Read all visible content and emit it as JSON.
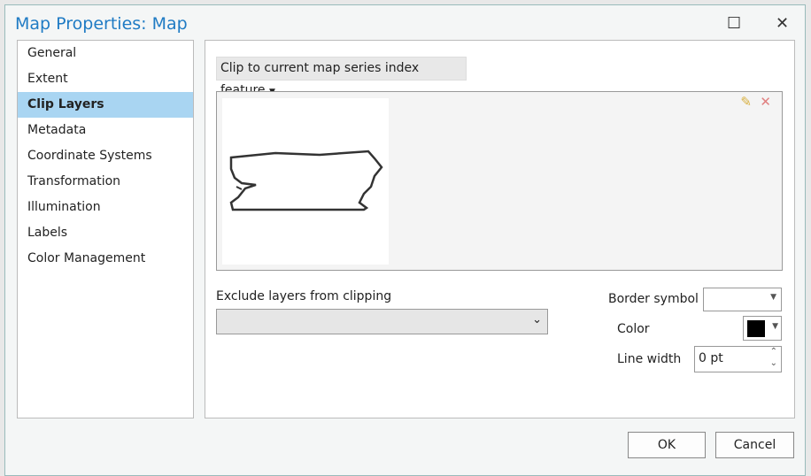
{
  "title": "Map Properties: Map",
  "nav": [
    "General",
    "Extent",
    "Clip Layers",
    "Metadata",
    "Coordinate Systems",
    "Transformation",
    "Illumination",
    "Labels",
    "Color Management"
  ],
  "selected": "Clip Layers",
  "clip_mode": "Clip to current map series index feature",
  "exclude_label": "Exclude layers from clipping",
  "exclude_value": "",
  "border_symbol_label": "Border symbol",
  "color_label": "Color",
  "color_value": "#000000",
  "line_width_label": "Line width",
  "line_width_value": "0 pt",
  "ok": "OK",
  "cancel": "Cancel"
}
